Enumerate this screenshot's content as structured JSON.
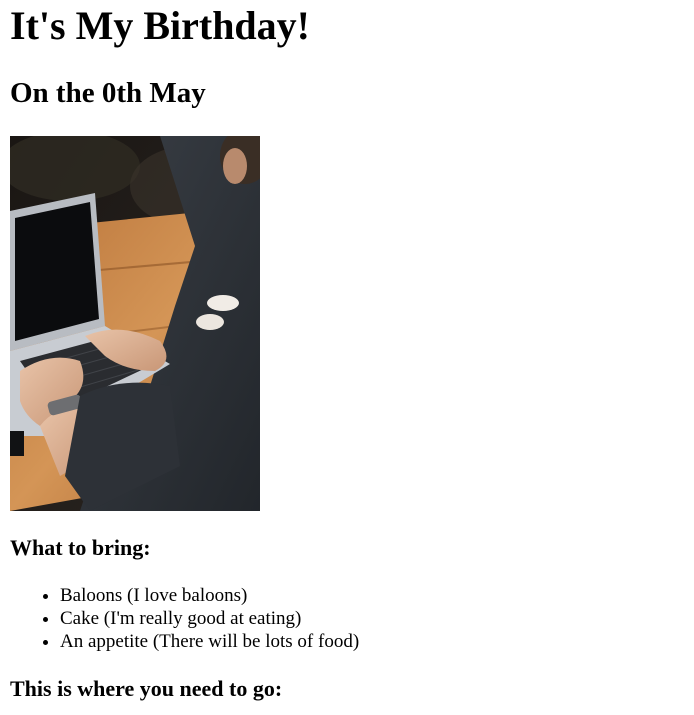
{
  "page": {
    "title": "It's My Birthday!",
    "date_heading": "On the 0th May",
    "photo_subject": "person typing on laptop at wooden table",
    "bring_heading": "What to bring:",
    "bring_items": [
      "Baloons (I love baloons)",
      "Cake (I'm really good at eating)",
      "An appetite (There will be lots of food)"
    ],
    "directions_heading": "This is where you need to go:"
  },
  "colors": {
    "text": "#000000",
    "background": "#ffffff"
  }
}
